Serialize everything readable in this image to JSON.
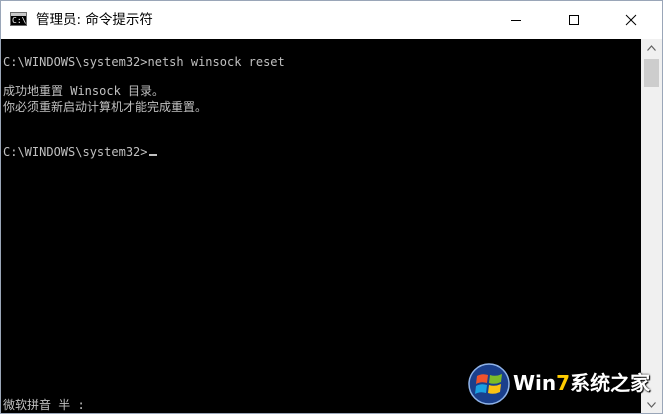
{
  "window": {
    "title": "管理员: 命令提示符",
    "app_icon_label": "C:\\"
  },
  "console": {
    "line1": "C:\\WINDOWS\\system32>netsh winsock reset",
    "line2": "成功地重置 Winsock 目录。",
    "line3": "你必须重新启动计算机才能完成重置。",
    "prompt": "C:\\WINDOWS\\system32>",
    "ime_status": "微软拼音 半 :"
  },
  "watermark": {
    "text_a": "Win",
    "text_seven": "7",
    "text_b": "系统之家"
  },
  "icons": {
    "minimize": "minimize-icon",
    "maximize": "maximize-icon",
    "close": "close-icon",
    "scroll_up": "arrow-up-icon",
    "scroll_down": "arrow-down-icon"
  }
}
